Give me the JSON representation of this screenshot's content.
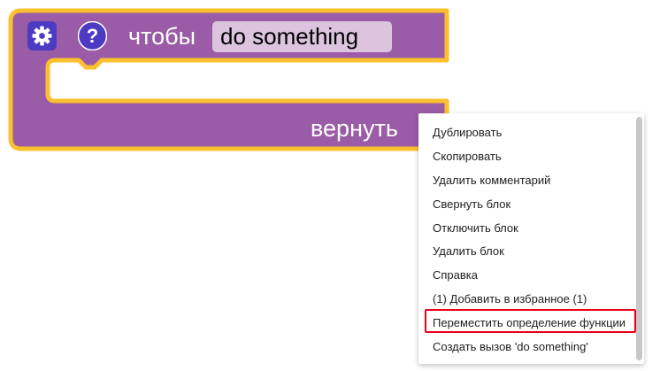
{
  "block": {
    "to_label": "чтобы",
    "function_name": "do something",
    "return_label": "вернуть",
    "colors": {
      "body": "#9a5ca6",
      "outline": "#fbc02d",
      "field_bg": "#dcc4df",
      "icon_bg": "#4c3bc2"
    },
    "icons": {
      "mutator": "gear-icon",
      "help": "question-mark-icon"
    }
  },
  "context_menu": {
    "items": [
      {
        "label": "Дублировать"
      },
      {
        "label": "Скопировать"
      },
      {
        "label": "Удалить комментарий"
      },
      {
        "label": "Свернуть блок"
      },
      {
        "label": "Отключить блок"
      },
      {
        "label": "Удалить блок"
      },
      {
        "label": "Справка"
      },
      {
        "label": "(1) Добавить в избранное (1)"
      },
      {
        "label": "Переместить определение функции"
      },
      {
        "label": "Создать вызов 'do something'"
      }
    ],
    "highlighted_item": "Переместить определение функции",
    "highlight_color": "#e8001b"
  }
}
